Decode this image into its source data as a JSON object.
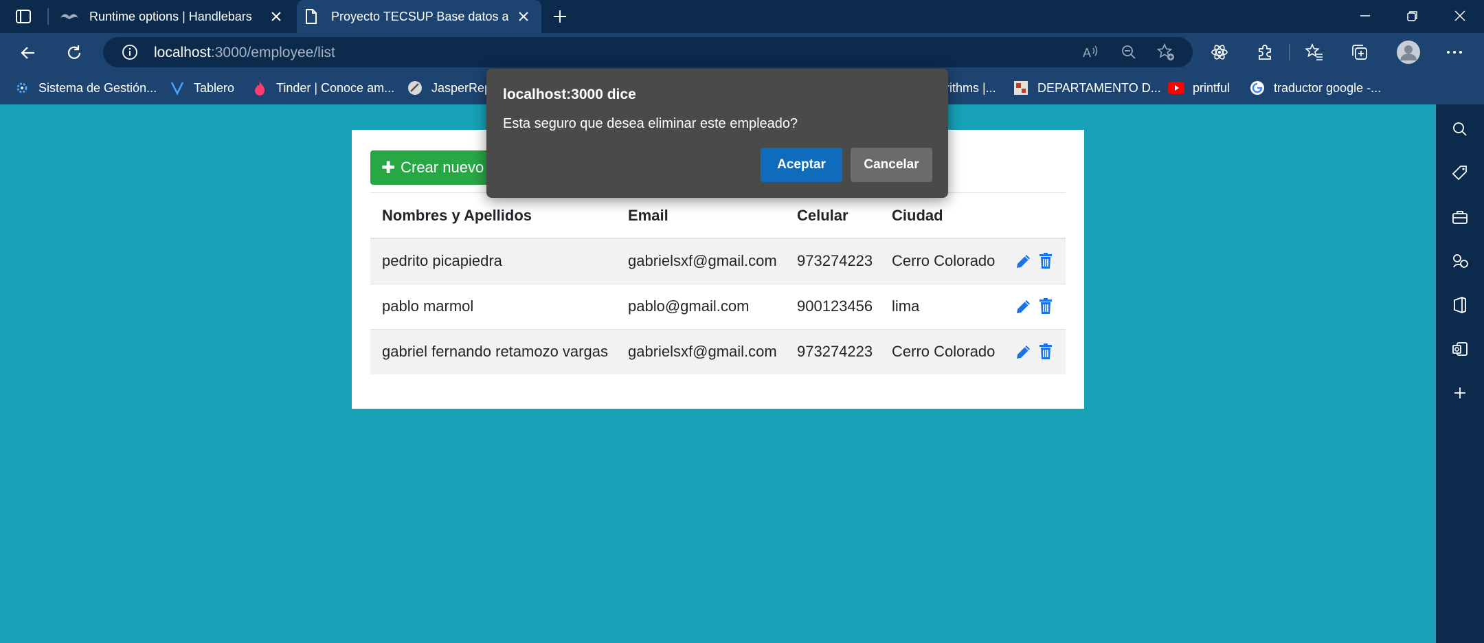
{
  "browser": {
    "tabs": [
      {
        "title": "Runtime options | Handlebars",
        "icon": "handlebars-icon",
        "active": false
      },
      {
        "title": "Proyecto TECSUP Base datos ava",
        "icon": "page-icon",
        "active": true
      }
    ],
    "address": {
      "host": "localhost",
      "path": ":3000/employee/list"
    },
    "bookmarks": [
      {
        "label": "Sistema de Gestión...",
        "icon": "gear-icon"
      },
      {
        "label": "Tablero",
        "icon": "v-logo-icon"
      },
      {
        "label": "Tinder | Conoce am...",
        "icon": "flame-icon"
      },
      {
        "label": "JasperRep",
        "icon": "jasper-icon"
      },
      {
        "label": "rithms |...",
        "icon": ""
      },
      {
        "label": "DEPARTAMENTO D...",
        "icon": "department-icon"
      },
      {
        "label": "printful",
        "icon": "youtube-icon"
      },
      {
        "label": "traductor google -...",
        "icon": "google-icon"
      }
    ]
  },
  "page": {
    "create_button_label": "Crear nuevo e",
    "table": {
      "headers": [
        "Nombres y Apellidos",
        "Email",
        "Celular",
        "Ciudad"
      ],
      "rows": [
        [
          "pedrito picapiedra",
          "gabrielsxf@gmail.com",
          "973274223",
          "Cerro Colorado"
        ],
        [
          "pablo marmol",
          "pablo@gmail.com",
          "900123456",
          "lima"
        ],
        [
          "gabriel fernando retamozo vargas",
          "gabrielsxf@gmail.com",
          "973274223",
          "Cerro Colorado"
        ]
      ]
    }
  },
  "dialog": {
    "title": "localhost:3000 dice",
    "message": "Esta seguro que desea eliminar este empleado?",
    "ok_label": "Aceptar",
    "cancel_label": "Cancelar"
  },
  "colors": {
    "page_background": "#17a2b8",
    "create_button": "#28a745",
    "action_icon": "#1a73e8",
    "dialog_background": "#4a4a4a",
    "dialog_ok": "#0f6cbd"
  }
}
